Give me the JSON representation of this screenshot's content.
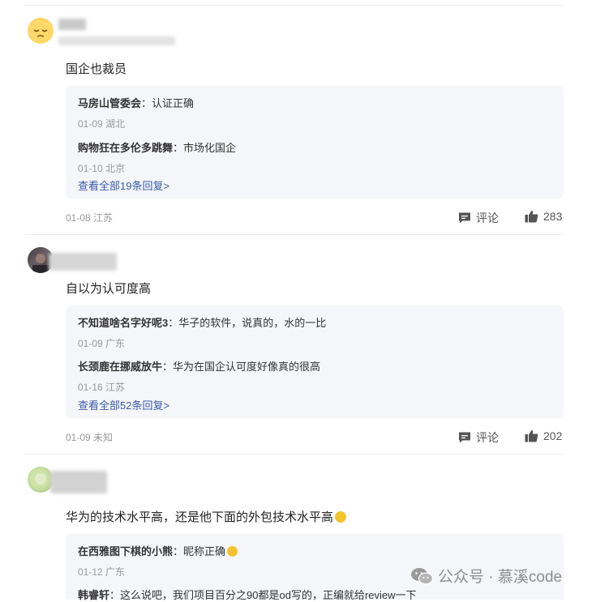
{
  "comments": [
    {
      "text": "国企也裁员",
      "replies": [
        {
          "name": "马房山管委会",
          "text": "认证正确",
          "meta": "01-09 湖北"
        },
        {
          "name": "购物狂在多伦多跳舞",
          "text": "市场化国企",
          "meta": "01-10 北京"
        }
      ],
      "view_all": "查看全部19条回复>",
      "meta": "01-08 江苏",
      "comment_label": "评论",
      "likes": "283"
    },
    {
      "text": "自以为认可度高",
      "replies": [
        {
          "name": "不知道啥名字好呢3",
          "text": "华子的软件，说真的，水的一比",
          "meta": "01-09 广东"
        },
        {
          "name": "长颈鹿在挪威放牛",
          "text": "华为在国企认可度好像真的很高",
          "meta": "01-16 江苏"
        }
      ],
      "view_all": "查看全部52条回复>",
      "meta": "01-09 未知",
      "comment_label": "评论",
      "likes": "202"
    },
    {
      "text": "华为的技术水平高，还是他下面的外包技术水平高",
      "replies": [
        {
          "name": "在西雅图下棋的小熊",
          "text": "昵称正确",
          "meta": "01-12 广东"
        },
        {
          "name": "韩睿轩",
          "text": "这么说吧，我们项目百分之90都是od写的，正编就给review一下",
          "meta": ""
        }
      ]
    }
  ],
  "watermark": "公众号 · 慕溪code",
  "colors": {
    "link": "#3a5aa9",
    "reply_bg": "#f5f6f9",
    "muted": "#999999"
  }
}
